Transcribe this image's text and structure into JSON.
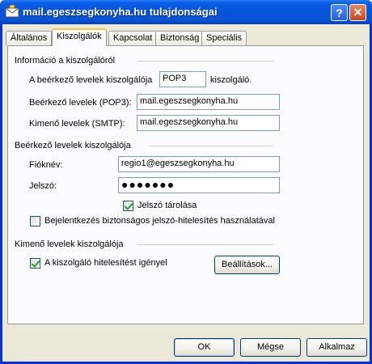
{
  "window": {
    "title": "mail.egeszsegkonyha.hu tulajdonságai",
    "help_label": "?",
    "close_label": "✕"
  },
  "tabs": [
    {
      "label": "Általános",
      "active": false
    },
    {
      "label": "Kiszolgálók",
      "active": true
    },
    {
      "label": "Kapcsolat",
      "active": false
    },
    {
      "label": "Biztonság",
      "active": false
    },
    {
      "label": "Speciális",
      "active": false
    }
  ],
  "server_info": {
    "heading": "Információ a kiszolgálóról",
    "incoming_type_prefix": "A beérkező levelek kiszolgálója",
    "incoming_type_value": "POP3",
    "incoming_type_suffix": "kiszolgáló.",
    "incoming_label": "Beérkező levelek (POP3):",
    "incoming_value": "mail.egeszsegkonyha.hu",
    "outgoing_label": "Kimenő levelek (SMTP):",
    "outgoing_value": "mail.egeszsegkonyha.hu"
  },
  "incoming_server": {
    "heading": "Beérkező levelek kiszolgálója",
    "account_label": "Fióknév:",
    "account_value": "regio1@egeszsegkonyha.hu",
    "password_label": "Jelszó:",
    "password_value": "●●●●●●●",
    "remember_label": "Jelszó tárolása",
    "remember_checked": true,
    "spa_label": "Bejelentkezés biztonságos jelszó-hitelesítés használatával",
    "spa_checked": false
  },
  "outgoing_server": {
    "heading": "Kimenő levelek kiszolgálója",
    "auth_label": "A kiszolgáló hitelesítést igényel",
    "auth_checked": true,
    "settings_button": "Beállítások..."
  },
  "footer": {
    "ok": "OK",
    "cancel": "Mégse",
    "apply": "Alkalmaz"
  },
  "colors": {
    "titlebar": "#0553d8",
    "dialog_bg": "#ece9d8",
    "tab_highlight": "#ffc83c"
  }
}
